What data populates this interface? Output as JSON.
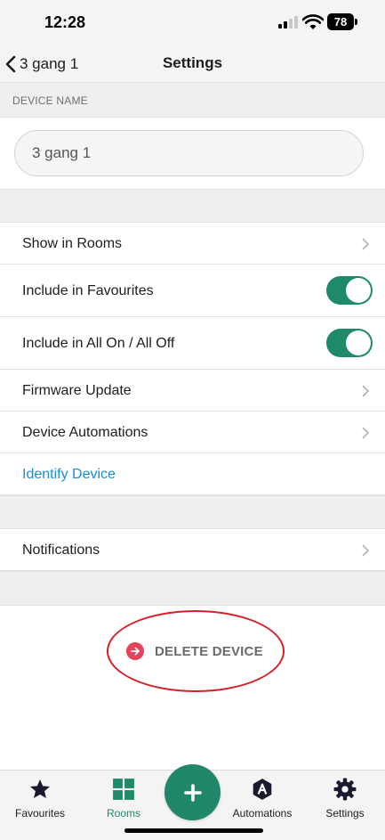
{
  "status_bar": {
    "time": "12:28",
    "battery": "78"
  },
  "nav": {
    "back_label": "3 gang 1",
    "title": "Settings"
  },
  "device_name": {
    "section_label": "DEVICE NAME",
    "value": "3 gang 1"
  },
  "settings": {
    "show_in_rooms": "Show in Rooms",
    "include_favourites": "Include in Favourites",
    "include_favourites_on": true,
    "include_all_on_off": "Include in All On / All Off",
    "include_all_on_off_on": true,
    "firmware_update": "Firmware Update",
    "device_automations": "Device Automations",
    "identify_device": "Identify Device",
    "notifications": "Notifications"
  },
  "delete": {
    "label": "DELETE DEVICE"
  },
  "tabs": [
    {
      "label": "Favourites",
      "icon": "star-icon"
    },
    {
      "label": "Rooms",
      "icon": "grid-icon",
      "active": true
    },
    {
      "label": "Automations",
      "icon": "automation-icon"
    },
    {
      "label": "Settings",
      "icon": "gear-icon"
    }
  ],
  "fab": {
    "icon": "plus-icon"
  },
  "colors": {
    "accent": "#1f8a6a",
    "link": "#1a8fd1",
    "delete": "#e8425a",
    "annotation": "#d81f26",
    "group_background": "#efefef"
  }
}
